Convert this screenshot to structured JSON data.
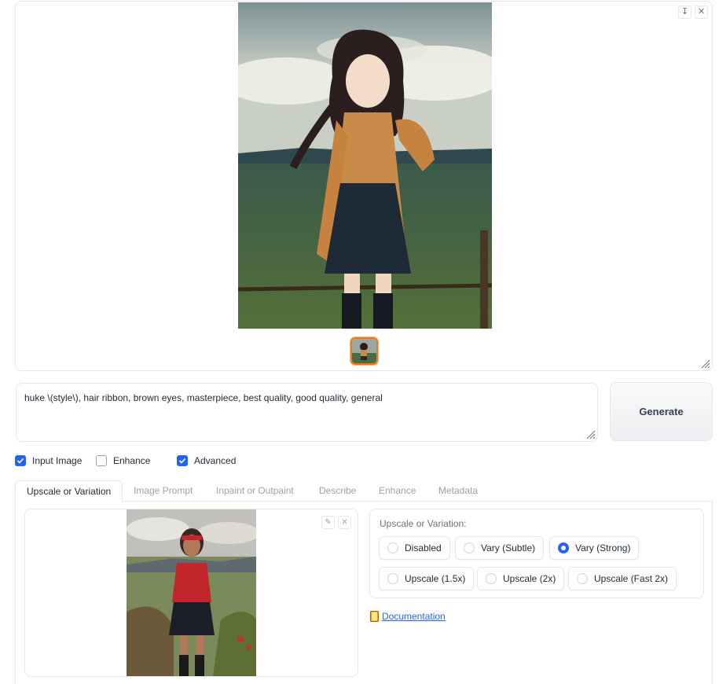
{
  "gallery": {
    "download_icon": "download-icon",
    "close_icon": "close-icon",
    "main_image": "anime girl with brown eyes and hair ribbon standing by a fence",
    "thumbnail": "gallery-thumbnail"
  },
  "prompt": {
    "value": "huke \\(style\\), hair ribbon, brown eyes, masterpiece, best quality, good quality, general"
  },
  "generate_label": "Generate",
  "checkboxes": [
    {
      "label": "Input Image",
      "checked": true
    },
    {
      "label": "Enhance",
      "checked": false
    },
    {
      "label": "Advanced",
      "checked": true
    }
  ],
  "tabs": [
    "Upscale or Variation",
    "Image Prompt",
    "Inpaint or Outpaint",
    "Describe",
    "Enhance",
    "Metadata"
  ],
  "upscale": {
    "label": "Upscale or Variation:",
    "options": [
      "Disabled",
      "Vary (Subtle)",
      "Vary (Strong)",
      "Upscale (1.5x)",
      "Upscale (2x)",
      "Upscale (Fast 2x)"
    ],
    "selected": "Vary (Strong)"
  },
  "documentation": {
    "icon": "book-icon",
    "label": "Documentation"
  },
  "colors": {
    "accent": "#2563eb",
    "thumb_border": "#f97316"
  }
}
